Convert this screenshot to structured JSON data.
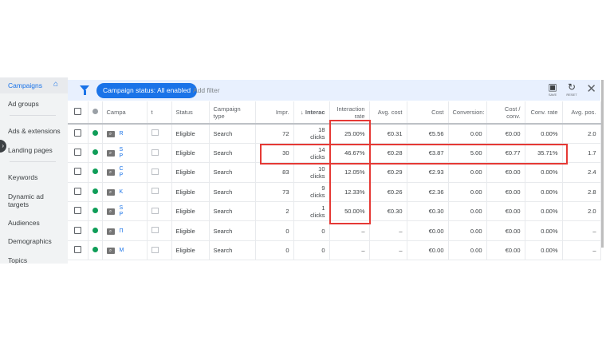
{
  "sidebar": {
    "items": [
      "Campaigns",
      "Ad groups",
      "Ads & extensions",
      "Landing pages",
      "Keywords",
      "Dynamic ad targets",
      "Audiences",
      "Demographics",
      "Topics"
    ]
  },
  "toolbar": {
    "chip": "Campaign status: All enabled",
    "add_filter": "Add filter",
    "save": "SAVE",
    "reset": "RESET"
  },
  "columns": [
    "Campa",
    "t",
    "Status",
    "Campaign type",
    "Impr.",
    "Interac",
    "Interaction rate",
    "Avg. cost",
    "Cost",
    "Conversion:",
    "Cost / conv.",
    "Conv. rate",
    "Avg. pos."
  ],
  "rows": [
    {
      "name": "R",
      "status": "Eligible",
      "type": "Search",
      "impr": "72",
      "inter": "18",
      "unit": "clicks",
      "rate": "25.00%",
      "avg": "€0.31",
      "cost": "€5.56",
      "conv": "0.00",
      "cpc": "€0.00",
      "cr": "0.00%",
      "pos": "2.0"
    },
    {
      "name": "S P",
      "status": "Eligible",
      "type": "Search",
      "impr": "30",
      "inter": "14",
      "unit": "clicks",
      "rate": "46.67%",
      "avg": "€0.28",
      "cost": "€3.87",
      "conv": "5.00",
      "cpc": "€0.77",
      "cr": "35.71%",
      "pos": "1.7"
    },
    {
      "name": "C P",
      "status": "Eligible",
      "type": "Search",
      "impr": "83",
      "inter": "10",
      "unit": "clicks",
      "rate": "12.05%",
      "avg": "€0.29",
      "cost": "€2.93",
      "conv": "0.00",
      "cpc": "€0.00",
      "cr": "0.00%",
      "pos": "2.4"
    },
    {
      "name": "K",
      "status": "Eligible",
      "type": "Search",
      "impr": "73",
      "inter": "9",
      "unit": "clicks",
      "rate": "12.33%",
      "avg": "€0.26",
      "cost": "€2.36",
      "conv": "0.00",
      "cpc": "€0.00",
      "cr": "0.00%",
      "pos": "2.8"
    },
    {
      "name": "S P",
      "status": "Eligible",
      "type": "Search",
      "impr": "2",
      "inter": "1",
      "unit": "clicks",
      "rate": "50.00%",
      "avg": "€0.30",
      "cost": "€0.30",
      "conv": "0.00",
      "cpc": "€0.00",
      "cr": "0.00%",
      "pos": "2.0"
    },
    {
      "name": "П",
      "status": "Eligible",
      "type": "Search",
      "impr": "0",
      "inter": "0",
      "unit": "",
      "rate": "–",
      "avg": "–",
      "cost": "€0.00",
      "conv": "0.00",
      "cpc": "€0.00",
      "cr": "0.00%",
      "pos": "–"
    },
    {
      "name": "M",
      "status": "Eligible",
      "type": "Search",
      "impr": "0",
      "inter": "0",
      "unit": "",
      "rate": "–",
      "avg": "–",
      "cost": "€0.00",
      "conv": "0.00",
      "cpc": "€0.00",
      "cr": "0.00%",
      "pos": "–"
    }
  ]
}
